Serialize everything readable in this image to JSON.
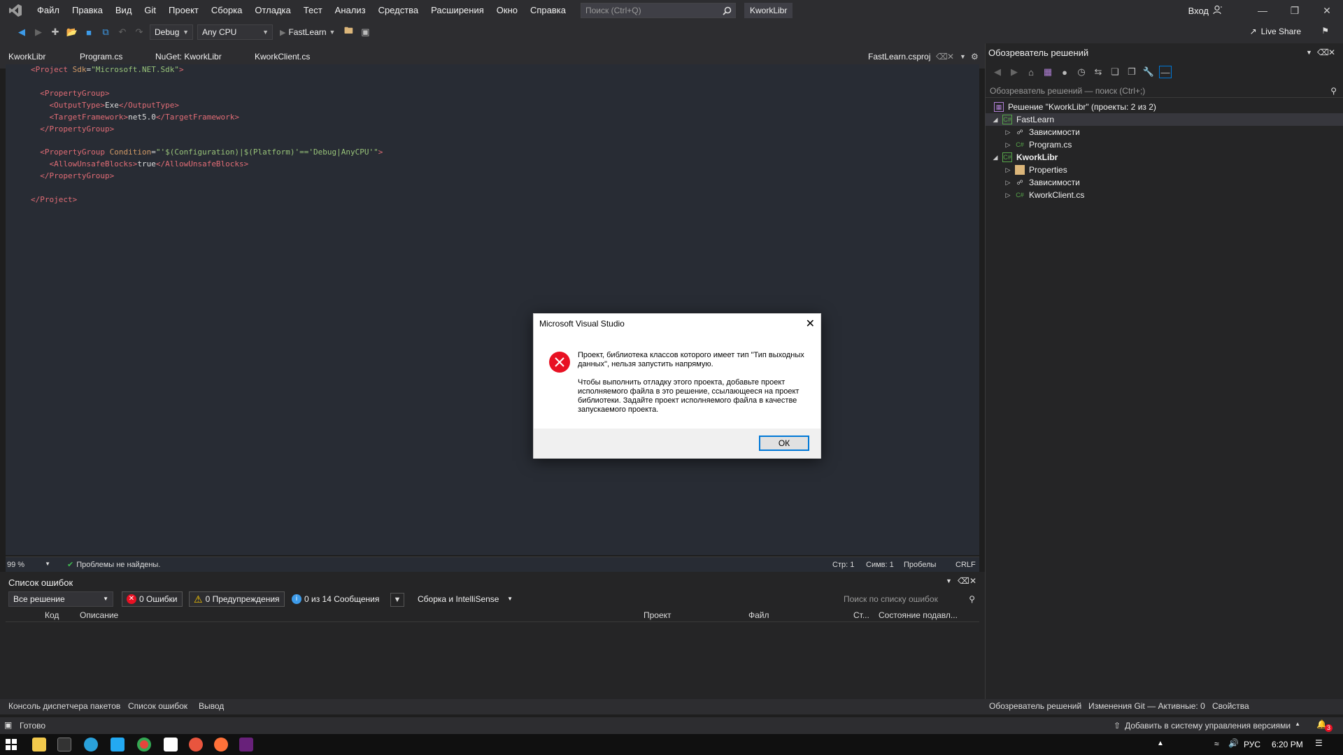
{
  "menubar": {
    "items": [
      "Файл",
      "Правка",
      "Вид",
      "Git",
      "Проект",
      "Сборка",
      "Отладка",
      "Тест",
      "Анализ",
      "Средства",
      "Расширения",
      "Окно",
      "Справка"
    ],
    "search_placeholder": "Поиск (Ctrl+Q)",
    "solution_name": "KworkLibr",
    "signin": "Вход"
  },
  "toolbar": {
    "config": "Debug",
    "platform": "Any CPU",
    "start_project": "FastLearn",
    "liveshare": "Live Share"
  },
  "doctabs": {
    "left": [
      "KworkLibr",
      "Program.cs",
      "NuGet: KworkLibr",
      "KworkClient.cs"
    ],
    "active": "FastLearn.csproj"
  },
  "editor": {
    "zoom": "99 %",
    "problems": "Проблемы не найдены.",
    "line": "Стр: 1",
    "col": "Симв: 1",
    "whitespace": "Пробелы",
    "eol": "CRLF"
  },
  "errlist": {
    "title": "Список ошибок",
    "scope": "Все решение",
    "errors": "0 Ошибки",
    "warnings": "0 Предупреждения",
    "messages": "0 из 14 Сообщения",
    "source": "Сборка и IntelliSense",
    "search_placeholder": "Поиск по списку ошибок",
    "columns": [
      "Код",
      "Описание",
      "Проект",
      "Файл",
      "Ст...",
      "Состояние подавл..."
    ]
  },
  "bottomtabs": {
    "left": [
      "Консоль диспетчера пакетов",
      "Список ошибок",
      "Вывод"
    ],
    "right": [
      "Обозреватель решений",
      "Изменения Git — Активные: 0",
      "Свойства"
    ]
  },
  "statusbar": {
    "ready": "Готово",
    "vcs": "Добавить в систему управления версиями",
    "notif_count": "3"
  },
  "taskbar": {
    "lang": "РУС",
    "time": "6:20 PM"
  },
  "solexp": {
    "title": "Обозреватель решений",
    "search_placeholder": "Обозреватель решений — поиск (Ctrl+;)",
    "tree": [
      {
        "label": "Решение \"KworkLibr\" (проекты: 2 из 2)",
        "level": 0
      },
      {
        "label": "FastLearn",
        "level": 1
      },
      {
        "label": "Зависимости",
        "level": 2
      },
      {
        "label": "Program.cs",
        "level": 2
      },
      {
        "label": "KworkLibr",
        "level": 1
      },
      {
        "label": "Properties",
        "level": 2
      },
      {
        "label": "Зависимости",
        "level": 2
      },
      {
        "label": "KworkClient.cs",
        "level": 2
      }
    ]
  },
  "dialog": {
    "title": "Microsoft Visual Studio",
    "msg1": "Проект, библиотека классов которого имеет тип \"Тип выходных данных\", нельзя запустить напрямую.",
    "msg2": "Чтобы выполнить отладку этого проекта, добавьте проект исполняемого файла в это решение, ссылающееся на проект библиотеки. Задайте проект исполняемого файла в качестве запускаемого проекта.",
    "ok": "ОК"
  },
  "code": {
    "l1_open": "<Project ",
    "l1_attr": "Sdk",
    "l1_str": "\"Microsoft.NET.Sdk\"",
    "l1_close": ">",
    "pg_open": "<PropertyGroup>",
    "ot_open": "<OutputType>",
    "ot_val": "Exe",
    "ot_close": "</OutputType>",
    "tf_open": "<TargetFramework>",
    "tf_val": "net5.0",
    "tf_close": "</TargetFramework>",
    "pg_close": "</PropertyGroup>",
    "pg2_open": "<PropertyGroup ",
    "pg2_attr": "Condition",
    "pg2_str": "\"'$(Configuration)|$(Platform)'=='Debug|AnyCPU'\"",
    "pg2_end": ">",
    "aub_open": "<AllowUnsafeBlocks>",
    "aub_val": "true",
    "aub_close": "</AllowUnsafeBlocks>",
    "proj_close": "</Project>"
  },
  "colors": {
    "accent": "#0078d7",
    "error": "#e81123",
    "warning": "#ffcc00",
    "tag": "#e06c75",
    "attr": "#d19a66",
    "string": "#98c379"
  }
}
